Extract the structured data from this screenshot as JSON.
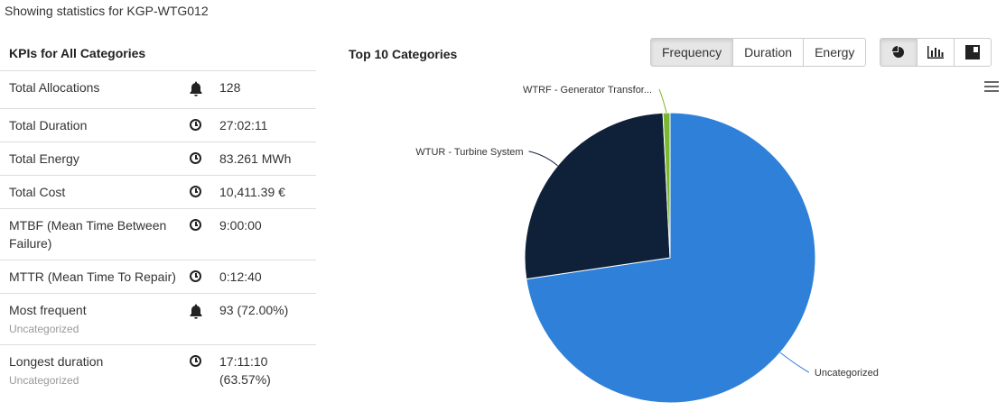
{
  "header": {
    "text": "Showing statistics for KGP-WTG012"
  },
  "kpi": {
    "title": "KPIs for All Categories",
    "rows": [
      {
        "label": "Total Allocations",
        "icon": "bell-icon",
        "value": "128",
        "sub": ""
      },
      {
        "label": "Total Duration",
        "icon": "clock-icon",
        "value": "27:02:11",
        "sub": ""
      },
      {
        "label": "Total Energy",
        "icon": "clock-icon",
        "value": "83.261 MWh",
        "sub": ""
      },
      {
        "label": "Total Cost",
        "icon": "clock-icon",
        "value": "10,411.39 €",
        "sub": ""
      },
      {
        "label": "MTBF (Mean Time Between Failure)",
        "icon": "clock-icon",
        "value": "9:00:00",
        "sub": ""
      },
      {
        "label": "MTTR (Mean Time To Repair)",
        "icon": "clock-icon",
        "value": "0:12:40",
        "sub": ""
      },
      {
        "label": "Most frequent",
        "icon": "bell-icon",
        "value": "93 (72.00%)",
        "sub": "Uncategorized"
      },
      {
        "label": "Longest duration",
        "icon": "clock-icon",
        "value": "17:11:10 (63.57%)",
        "sub": "Uncategorized"
      }
    ]
  },
  "chart": {
    "title": "Top 10 Categories",
    "metric_buttons": [
      "Frequency",
      "Duration",
      "Energy"
    ],
    "active_metric": "Frequency",
    "view_buttons": [
      "pie-chart-icon",
      "bar-chart-icon",
      "table-layout-icon"
    ],
    "active_view": "pie-chart-icon",
    "menu_icon": "hamburger-menu-icon"
  },
  "chart_data": {
    "type": "pie",
    "title": "Top 10 Categories",
    "slices": [
      {
        "label": "Uncategorized",
        "value": 93,
        "color": "#2f80d8"
      },
      {
        "label": "WTUR - Turbine System",
        "value": 34,
        "color": "#0f2139"
      },
      {
        "label": "WTRF - Generator Transfor...",
        "value": 1,
        "color": "#7cb82f"
      }
    ]
  }
}
